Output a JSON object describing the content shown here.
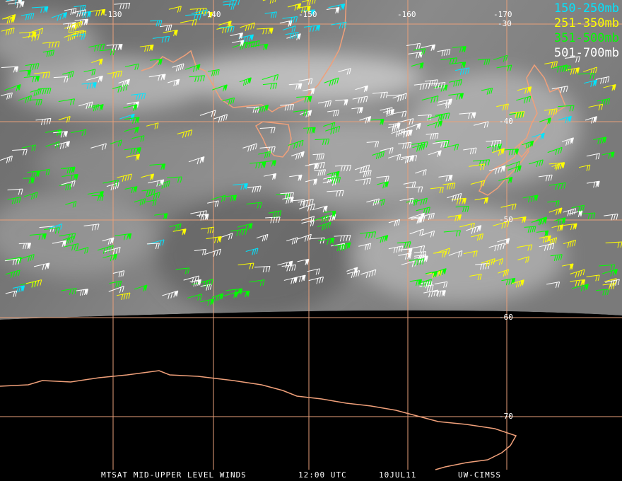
{
  "map": {
    "colors": {
      "grid": "#e8a07a",
      "coast": "#f0a07a",
      "band_150_250": "#00e5ff",
      "band_251_350": "#ffff00",
      "band_351_500": "#00ff00",
      "band_501_700": "#ffffff",
      "earth_edge": "#000000"
    },
    "lon_labels": [
      "-130",
      "-140",
      "-150",
      "-160",
      "-170"
    ],
    "lat_labels": [
      "-30",
      "-40",
      "-50",
      "-60",
      "-70"
    ]
  },
  "legend": [
    {
      "label": "150-250mb",
      "color": "#00e5ff"
    },
    {
      "label": "251-350mb",
      "color": "#ffff00"
    },
    {
      "label": "351-500mb",
      "color": "#00ff00"
    },
    {
      "label": "501-700mb",
      "color": "#ffffff"
    }
  ],
  "footer": {
    "product": "MTSAT MID-UPPER LEVEL WINDS",
    "time": "12:00 UTC",
    "date": "10JUL11",
    "source": "UW-CIMSS"
  }
}
